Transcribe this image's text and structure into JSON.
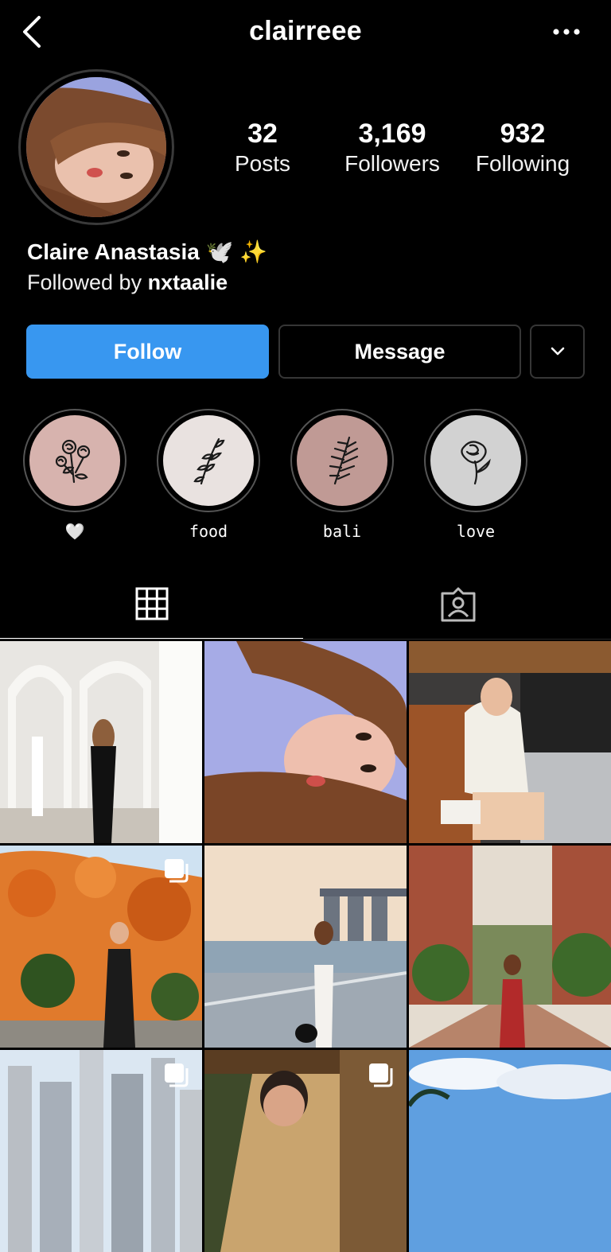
{
  "header": {
    "username": "clairreee"
  },
  "stats": [
    {
      "value": "32",
      "label": "Posts"
    },
    {
      "value": "3,169",
      "label": "Followers"
    },
    {
      "value": "932",
      "label": "Following"
    }
  ],
  "bio": {
    "name": "Claire Anastasia 🕊️ ✨",
    "followed_prefix": "Followed by ",
    "followed_user": "nxtaalie"
  },
  "buttons": {
    "follow": "Follow",
    "message": "Message"
  },
  "highlights": [
    {
      "label": "🤍",
      "color": "#d7b3ae",
      "icon": "roses-icon"
    },
    {
      "label": "food",
      "color": "#e9e2e0",
      "icon": "leaf-sprig-icon"
    },
    {
      "label": "bali",
      "color": "#c09a95",
      "icon": "fern-icon"
    },
    {
      "label": "love",
      "color": "#d2d2d2",
      "icon": "rose-icon"
    }
  ],
  "tabs": [
    {
      "name": "grid",
      "icon": "grid-icon",
      "active": true
    },
    {
      "name": "tagged",
      "icon": "tagged-icon",
      "active": false
    }
  ],
  "posts": [
    {
      "kind": "arches",
      "multi": false
    },
    {
      "kind": "selfie",
      "multi": false
    },
    {
      "kind": "car",
      "multi": false
    },
    {
      "kind": "flowers",
      "multi": true
    },
    {
      "kind": "waterfront",
      "multi": false
    },
    {
      "kind": "buildings",
      "multi": false
    },
    {
      "kind": "city",
      "multi": true
    },
    {
      "kind": "person",
      "multi": true
    },
    {
      "kind": "sky",
      "multi": false
    }
  ]
}
